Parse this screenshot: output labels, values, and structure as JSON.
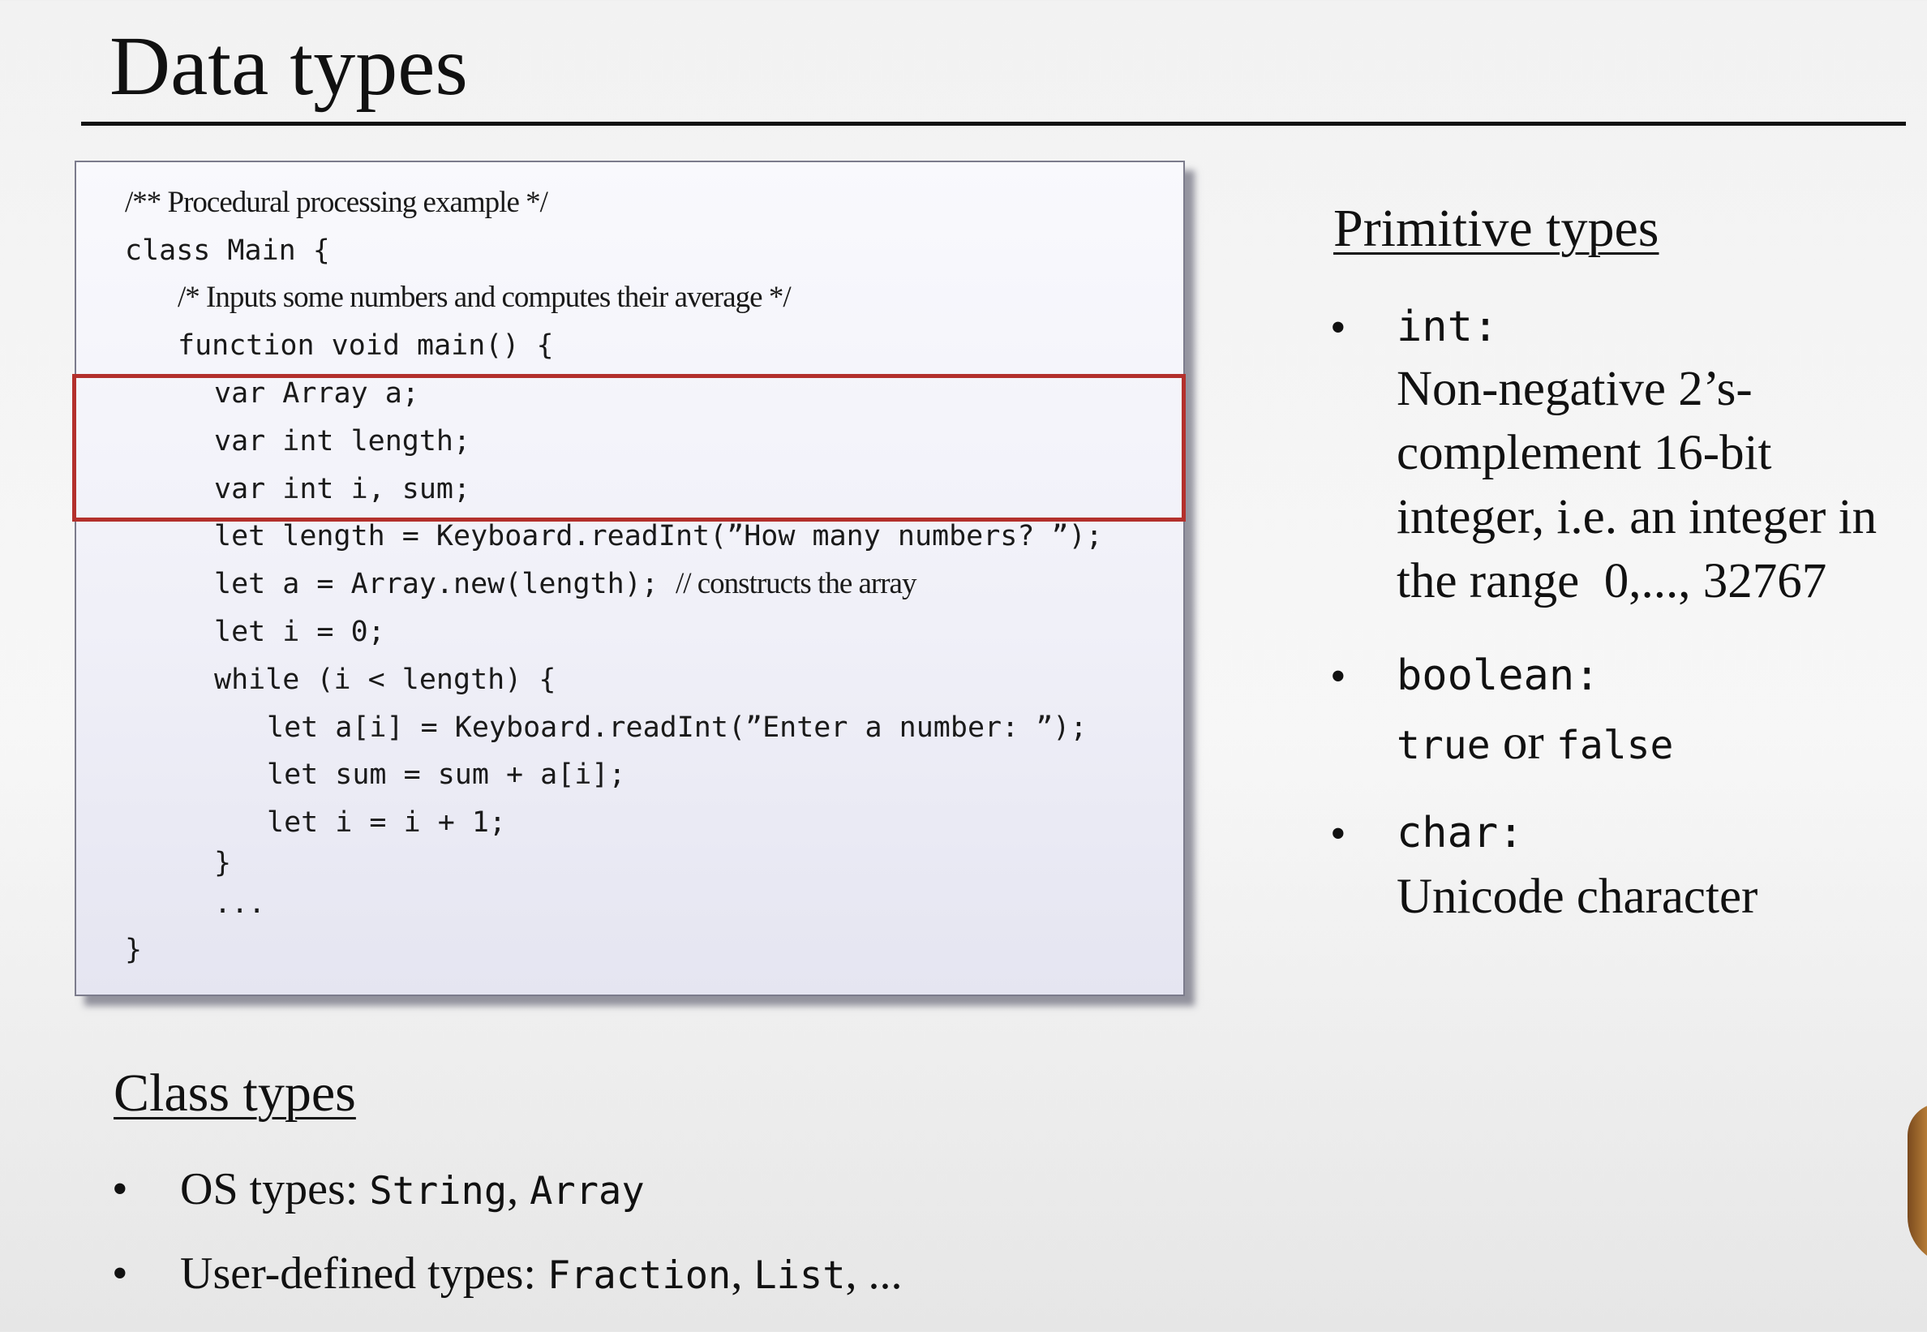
{
  "slide": {
    "title": "Data types"
  },
  "code": {
    "lines": [
      {
        "parts": [
          {
            "t": "/** Procedural processing example */",
            "k": "cmt"
          }
        ]
      },
      {
        "parts": [
          {
            "t": "class Main {",
            "k": "code"
          }
        ]
      },
      {
        "parts": [
          {
            "t": "/* Inputs some numbers and computes their average */",
            "k": "cmt"
          }
        ]
      },
      {
        "parts": [
          {
            "t": "function void main() {",
            "k": "code"
          }
        ]
      },
      {
        "parts": [
          {
            "t": "var Array a;",
            "k": "code"
          }
        ]
      },
      {
        "parts": [
          {
            "t": "var int length;",
            "k": "code"
          }
        ]
      },
      {
        "parts": [
          {
            "t": "var int i, sum;",
            "k": "code"
          }
        ]
      },
      {
        "parts": [
          {
            "t": "let length = Keyboard.readInt(”How many numbers? ”);",
            "k": "code"
          }
        ]
      },
      {
        "parts": [
          {
            "t": "let a = Array.new(length); ",
            "k": "code"
          },
          {
            "t": "// constructs the array",
            "k": "cmt"
          }
        ]
      },
      {
        "parts": [
          {
            "t": "let i = 0;",
            "k": "code"
          }
        ]
      },
      {
        "parts": [
          {
            "t": "while (i < length) {",
            "k": "code"
          }
        ]
      },
      {
        "parts": [
          {
            "t": "let a[i] = Keyboard.readInt(”Enter a number: ”);",
            "k": "code"
          }
        ]
      },
      {
        "parts": [
          {
            "t": "let sum = sum + a[i];",
            "k": "code"
          }
        ]
      },
      {
        "parts": [
          {
            "t": "let i = i + 1;",
            "k": "code"
          }
        ]
      },
      {
        "parts": [
          {
            "t": "}",
            "k": "code"
          }
        ]
      },
      {
        "parts": [
          {
            "t": "...",
            "k": "code"
          }
        ]
      },
      {
        "parts": [
          {
            "t": "}",
            "k": "code"
          }
        ]
      }
    ]
  },
  "primitive": {
    "heading": "Primitive types",
    "items": [
      {
        "name": "int:",
        "desc_lines": [
          "Non-negative 2’s-",
          "complement 16-bit",
          "integer, i.e. an integer in",
          "the range  0,..., 32767"
        ]
      },
      {
        "name": "boolean:",
        "value_true": "true",
        "value_or": " or ",
        "value_false": "false"
      },
      {
        "name": "char:",
        "desc_lines": [
          "Unicode character"
        ]
      }
    ]
  },
  "class_types": {
    "heading": "Class types",
    "items": [
      {
        "label": "OS types: ",
        "types": "String",
        "sep": ", ",
        "types2": "Array",
        "tail": ""
      },
      {
        "label": "User-defined types: ",
        "types": "Fraction",
        "sep": ", ",
        "types2": "List",
        "tail": ", ..."
      }
    ]
  },
  "bullet_glyph": "•"
}
